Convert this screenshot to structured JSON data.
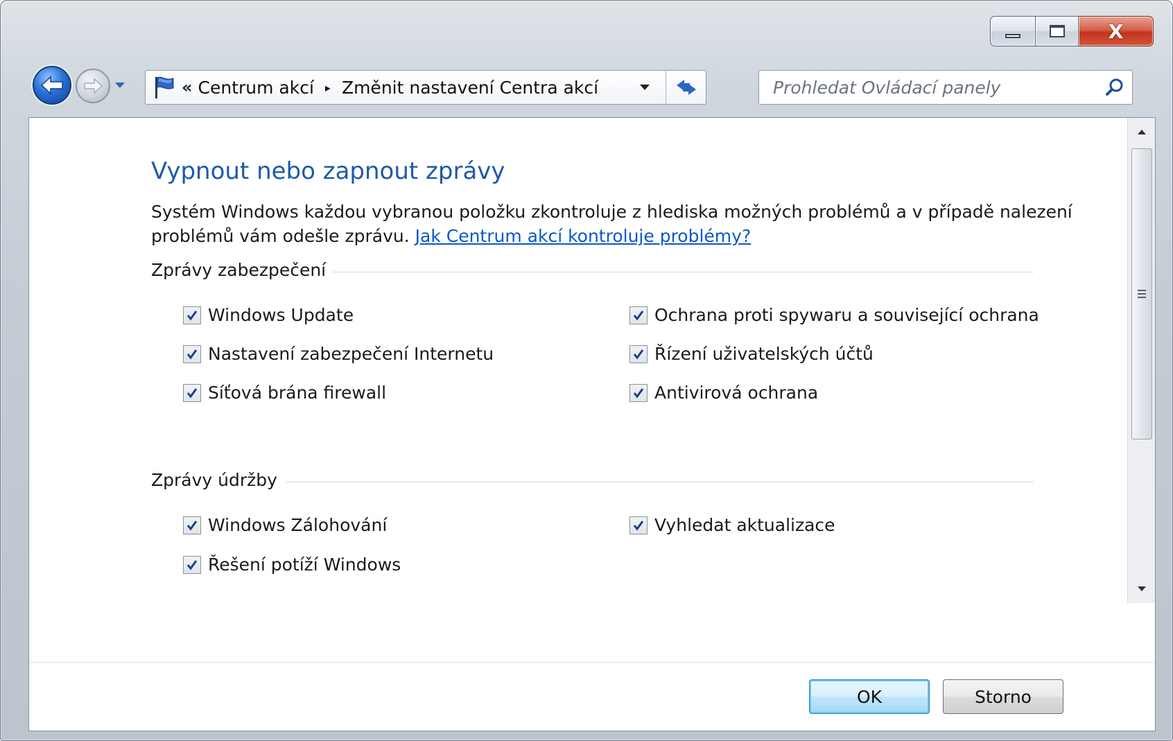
{
  "window": {
    "caption": {
      "minimize_icon": "minimize-icon",
      "maximize_icon": "maximize-icon",
      "close_glyph": "X"
    }
  },
  "nav": {
    "back_icon": "back-arrow-icon",
    "forward_icon": "forward-arrow-icon",
    "history_icon": "history-dropdown-icon"
  },
  "address": {
    "icon": "action-center-flag-icon",
    "overflow": "«",
    "crumbs": [
      "Centrum akcí",
      "Změnit nastavení Centra akcí"
    ],
    "separator": "▸"
  },
  "search": {
    "placeholder": "Prohledat Ovládací panely"
  },
  "main": {
    "heading": "Vypnout nebo zapnout zprávy",
    "description": "Systém Windows každou vybranou položku zkontroluje z hlediska možných problémů a v případě nalezení problémů vám odešle zprávu.",
    "help_link": "Jak Centrum akcí kontroluje problémy?",
    "groups": [
      {
        "title": "Zprávy zabezpečení",
        "items": [
          {
            "label": "Windows Update",
            "checked": true
          },
          {
            "label": "Ochrana proti spywaru a související ochrana",
            "checked": true
          },
          {
            "label": "Nastavení zabezpečení Internetu",
            "checked": true
          },
          {
            "label": "Řízení uživatelských účtů",
            "checked": true
          },
          {
            "label": "Síťová brána firewall",
            "checked": true
          },
          {
            "label": "Antivirová ochrana",
            "checked": true
          }
        ]
      },
      {
        "title": "Zprávy údržby",
        "items": [
          {
            "label": "Windows Zálohování",
            "checked": true
          },
          {
            "label": "Vyhledat aktualizace",
            "checked": true
          },
          {
            "label": "Řešení potíží Windows",
            "checked": true
          }
        ]
      }
    ]
  },
  "footer": {
    "ok": "OK",
    "cancel": "Storno"
  },
  "colors": {
    "heading": "#1e5aa8",
    "link": "#0b58c9",
    "accent_button": "#5fcaf2"
  }
}
